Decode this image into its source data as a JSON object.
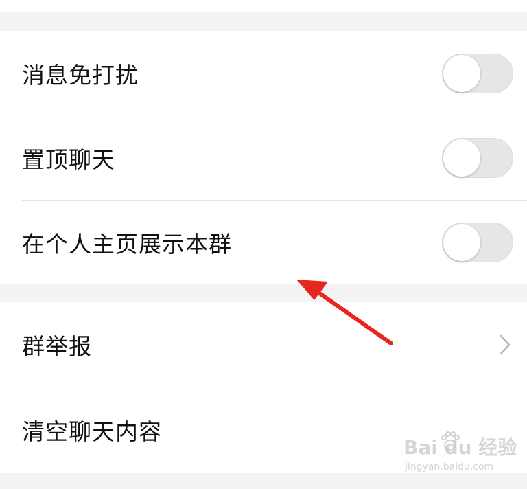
{
  "settings": {
    "group1": [
      {
        "label": "消息免打扰",
        "control": "toggle",
        "on": false
      },
      {
        "label": "置顶聊天",
        "control": "toggle",
        "on": false
      },
      {
        "label": "在个人主页展示本群",
        "control": "toggle",
        "on": false
      }
    ],
    "group2": [
      {
        "label": "群举报",
        "control": "chevron-right-icon"
      },
      {
        "label": "清空聊天内容"
      }
    ]
  },
  "annotation": {
    "arrow_color": "#e8251f"
  },
  "watermark": {
    "logo_text": "Bai du 经验",
    "url": "jingyan.baidu.com"
  },
  "colors": {
    "background": "#ffffff",
    "section_gap": "#f3f3f3",
    "toggle_off_track": "#e6e6e6",
    "divider": "#e4e4e4",
    "label_text": "#111111"
  }
}
